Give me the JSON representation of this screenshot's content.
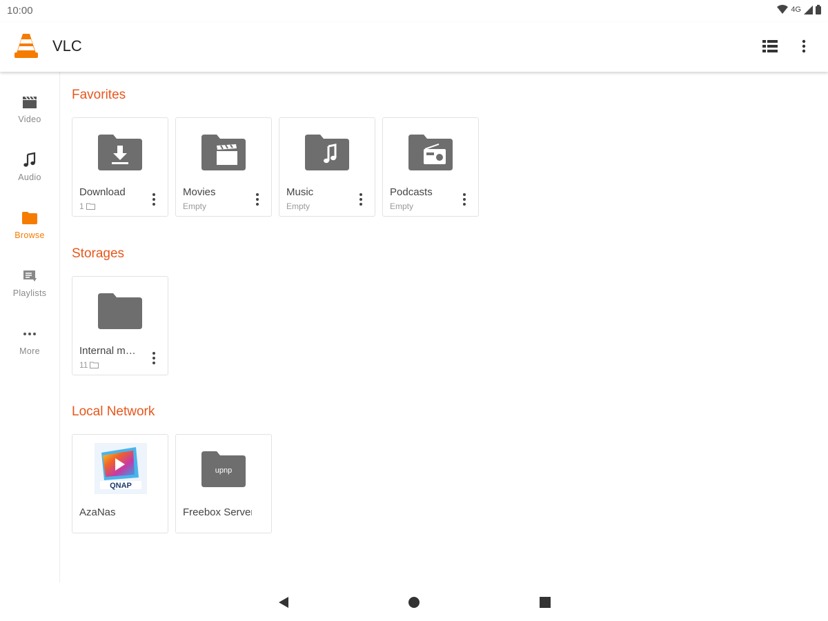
{
  "status": {
    "time": "10:00",
    "network": "4G"
  },
  "appbar": {
    "title": "VLC",
    "list_icon": "list-view-icon",
    "menu_icon": "overflow-menu-icon"
  },
  "sidebar": {
    "items": [
      {
        "label": "Video",
        "icon": "video-clapper-icon",
        "active": false
      },
      {
        "label": "Audio",
        "icon": "music-note-icon",
        "active": false
      },
      {
        "label": "Browse",
        "icon": "folder-icon",
        "active": true
      },
      {
        "label": "Playlists",
        "icon": "playlist-icon",
        "active": false
      },
      {
        "label": "More",
        "icon": "more-horiz-icon",
        "active": false
      }
    ]
  },
  "sections": {
    "favorites": {
      "title": "Favorites",
      "items": [
        {
          "name": "Download",
          "sub": "1",
          "icon": "folder-download-icon"
        },
        {
          "name": "Movies",
          "sub": "Empty",
          "icon": "folder-movie-icon"
        },
        {
          "name": "Music",
          "sub": "Empty",
          "icon": "folder-music-icon"
        },
        {
          "name": "Podcasts",
          "sub": "Empty",
          "icon": "folder-radio-icon"
        }
      ]
    },
    "storages": {
      "title": "Storages",
      "items": [
        {
          "name": "Internal m…",
          "sub": "11",
          "icon": "folder-icon"
        }
      ]
    },
    "network": {
      "title": "Local Network",
      "items": [
        {
          "name": "AzaNas",
          "icon": "qnap-logo-icon",
          "logo_text": "QNAP"
        },
        {
          "name": "Freebox Server",
          "icon": "upnp-folder-icon",
          "logo_text": "upnp"
        }
      ]
    }
  },
  "colors": {
    "accent": "#f57c00",
    "section": "#e8561c",
    "folder": "#6e6e6e"
  }
}
